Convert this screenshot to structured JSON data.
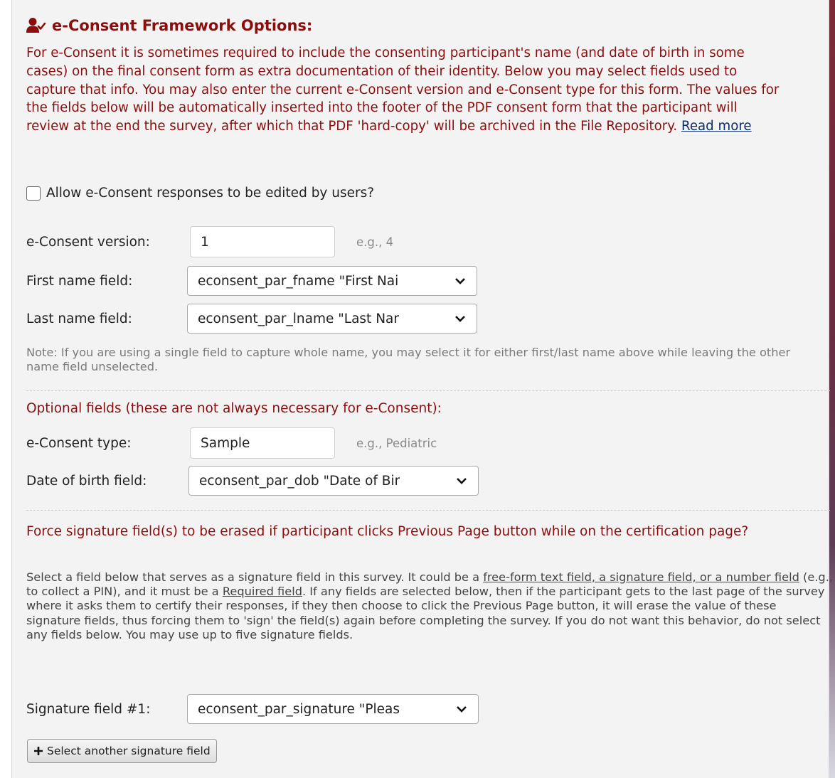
{
  "colors": {
    "heading": "#8b0e0e",
    "link": "#0c2d6b",
    "panel_bg": "#f3f3f3"
  },
  "header": {
    "icon": "user-check-icon",
    "title": "e-Consent Framework Options:"
  },
  "intro": {
    "text": "For e-Consent it is sometimes required to include the consenting participant's name (and date of birth in some cases) on the final consent form as extra documentation of their identity. Below you may select fields used to capture that info. You may also enter the current e-Consent version and e-Consent type for this form. The values for the fields below will be automatically inserted into the footer of the PDF consent form that the participant will review at the end the survey, after which that PDF 'hard-copy' will be archived in the File Repository. ",
    "read_more": "Read more"
  },
  "allow_edit": {
    "label": "Allow e-Consent responses to be edited by users?",
    "checked": false
  },
  "version": {
    "label": "e-Consent version:",
    "value": "1",
    "hint": "e.g., 4"
  },
  "first_name": {
    "label": "First name field:",
    "value": "econsent_par_fname \"First Nai"
  },
  "last_name": {
    "label": "Last name field:",
    "value": "econsent_par_lname \"Last Nar"
  },
  "name_note": "Note: If you are using a single field to capture whole name, you may select it for either first/last name above while leaving the other name field unselected.",
  "optional": {
    "heading": "Optional fields (these are not always necessary for e-Consent):",
    "type": {
      "label": "e-Consent type:",
      "value": "Sample",
      "hint": "e.g., Pediatric"
    },
    "dob": {
      "label": "Date of birth field:",
      "value": "econsent_par_dob \"Date of Bir"
    }
  },
  "signature": {
    "heading": "Force signature field(s) to be erased if participant clicks Previous Page button while on the certification page?",
    "desc_1": "Select a field below that serves as a signature field in this survey. It could be a ",
    "desc_link_1": "free-form text field, a signature field, or a number field",
    "desc_2": " (e.g., to collect a PIN), and it must be a ",
    "desc_link_2": "Required field",
    "desc_3": ". If any fields are selected below, then if the participant gets to the last page of the survey where it asks them to certify their responses, if they then choose to click the Previous Page button, it will erase the value of these signature fields, thus forcing them to 'sign' the field(s) again before completing the survey. If you do not want this behavior, do not select any fields below. You may use up to five signature fields.",
    "field1": {
      "label": "Signature field #1:",
      "value": "econsent_par_signature \"Pleas"
    },
    "add_button": "Select another signature field",
    "add_icon": "plus-icon"
  }
}
